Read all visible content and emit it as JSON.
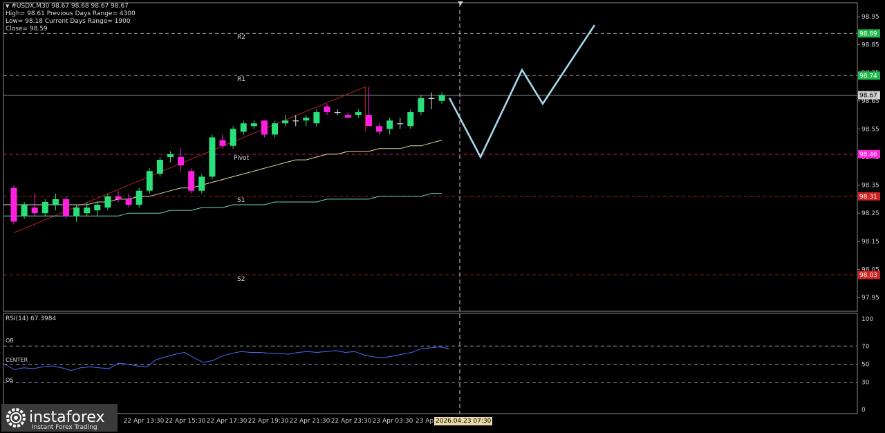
{
  "header": {
    "symbol_line": "#USDX,M30  98.67 98.68 98.67 98.67",
    "line2": "High= 98.61    Previous Days Range= 4300",
    "line3": "Low= 98.18    Current Days Range= 1900",
    "line4": "Close= 98.59"
  },
  "rsi": {
    "label": "RSI(14) 67.3984"
  },
  "levels_text": {
    "r2": "R2",
    "r1": "R1",
    "pivot": "Pivot",
    "s1": "S1",
    "s2": "S2",
    "ob": "OB",
    "center": "CENTER",
    "os": "OS"
  },
  "logo": {
    "name": "instaforex",
    "tagline": "Instant Forex Trading"
  },
  "cursor_time": "2026.04.23 07:30",
  "colors": {
    "bull": "#29e07a",
    "bear": "#ff1fe0",
    "forecast": "#a9d8f0",
    "rsi_line": "#4d6bff",
    "ma_slow": "#6fd6c0",
    "ma_fast": "#e8d9a6",
    "channel": "#b02020"
  },
  "chart_data": {
    "type": "candlestick",
    "price_axis": {
      "min": 97.95,
      "max": 98.95,
      "ticks": [
        "98.95",
        "98.85",
        "98.75",
        "98.65",
        "98.55",
        "98.45",
        "98.35",
        "98.25",
        "98.15",
        "98.05",
        "97.95"
      ]
    },
    "price_tags": [
      {
        "label": "98.89",
        "value": 98.89,
        "color": "#1fb84a",
        "level": "R2"
      },
      {
        "label": "98.74",
        "value": 98.74,
        "color": "#1fb84a",
        "level": "R1"
      },
      {
        "label": "98.67",
        "value": 98.67,
        "color": "#cfcfcf",
        "level": "current"
      },
      {
        "label": "98.46",
        "value": 98.46,
        "color": "#ff22dd",
        "level": "Pivot"
      },
      {
        "label": "98.31",
        "value": 98.31,
        "color": "#cc2222",
        "level": "S1"
      },
      {
        "label": "98.03",
        "value": 98.03,
        "color": "#cc2222",
        "level": "S2"
      }
    ],
    "time_labels": [
      "22 Apr 13:30",
      "22 Apr 15:30",
      "22 Apr 17:30",
      "22 Apr 19:30",
      "22 Apr 21:30",
      "22 Apr 23:30",
      "23 Apr 03:30",
      "23 Ap"
    ],
    "candles": [
      {
        "o": 98.34,
        "h": 98.35,
        "l": 98.21,
        "c": 98.22
      },
      {
        "o": 98.24,
        "h": 98.29,
        "l": 98.23,
        "c": 98.28
      },
      {
        "o": 98.27,
        "h": 98.32,
        "l": 98.24,
        "c": 98.25
      },
      {
        "o": 98.25,
        "h": 98.3,
        "l": 98.24,
        "c": 98.29
      },
      {
        "o": 98.28,
        "h": 98.32,
        "l": 98.26,
        "c": 98.3
      },
      {
        "o": 98.3,
        "h": 98.31,
        "l": 98.23,
        "c": 98.24
      },
      {
        "o": 98.24,
        "h": 98.28,
        "l": 98.22,
        "c": 98.27
      },
      {
        "o": 98.25,
        "h": 98.29,
        "l": 98.24,
        "c": 98.27
      },
      {
        "o": 98.26,
        "h": 98.29,
        "l": 98.24,
        "c": 98.28
      },
      {
        "o": 98.27,
        "h": 98.32,
        "l": 98.26,
        "c": 98.31
      },
      {
        "o": 98.31,
        "h": 98.33,
        "l": 98.29,
        "c": 98.3
      },
      {
        "o": 98.3,
        "h": 98.32,
        "l": 98.27,
        "c": 98.28
      },
      {
        "o": 98.28,
        "h": 98.34,
        "l": 98.27,
        "c": 98.33
      },
      {
        "o": 98.33,
        "h": 98.41,
        "l": 98.32,
        "c": 98.4
      },
      {
        "o": 98.39,
        "h": 98.45,
        "l": 98.38,
        "c": 98.44
      },
      {
        "o": 98.45,
        "h": 98.47,
        "l": 98.43,
        "c": 98.46
      },
      {
        "o": 98.45,
        "h": 98.48,
        "l": 98.4,
        "c": 98.42
      },
      {
        "o": 98.4,
        "h": 98.41,
        "l": 98.32,
        "c": 98.33
      },
      {
        "o": 98.33,
        "h": 98.39,
        "l": 98.32,
        "c": 98.38
      },
      {
        "o": 98.38,
        "h": 98.53,
        "l": 98.37,
        "c": 98.52
      },
      {
        "o": 98.51,
        "h": 98.53,
        "l": 98.48,
        "c": 98.49
      },
      {
        "o": 98.49,
        "h": 98.56,
        "l": 98.48,
        "c": 98.55
      },
      {
        "o": 98.54,
        "h": 98.58,
        "l": 98.53,
        "c": 98.57
      },
      {
        "o": 98.56,
        "h": 98.58,
        "l": 98.55,
        "c": 98.57
      },
      {
        "o": 98.58,
        "h": 98.58,
        "l": 98.52,
        "c": 98.53
      },
      {
        "o": 98.53,
        "h": 98.58,
        "l": 98.52,
        "c": 98.57
      },
      {
        "o": 98.57,
        "h": 98.6,
        "l": 98.56,
        "c": 98.58
      },
      {
        "o": 98.58,
        "h": 98.6,
        "l": 98.56,
        "c": 98.58
      },
      {
        "o": 98.58,
        "h": 98.6,
        "l": 98.56,
        "c": 98.59
      },
      {
        "o": 98.57,
        "h": 98.62,
        "l": 98.56,
        "c": 98.61
      },
      {
        "o": 98.63,
        "h": 98.64,
        "l": 98.6,
        "c": 98.61
      },
      {
        "o": 98.61,
        "h": 98.62,
        "l": 98.6,
        "c": 98.61
      },
      {
        "o": 98.6,
        "h": 98.61,
        "l": 98.59,
        "c": 98.59
      },
      {
        "o": 98.6,
        "h": 98.62,
        "l": 98.59,
        "c": 98.61
      },
      {
        "o": 98.6,
        "h": 98.7,
        "l": 98.56,
        "c": 98.56
      },
      {
        "o": 98.56,
        "h": 98.57,
        "l": 98.53,
        "c": 98.54
      },
      {
        "o": 98.55,
        "h": 98.59,
        "l": 98.53,
        "c": 98.58
      },
      {
        "o": 98.57,
        "h": 98.59,
        "l": 98.55,
        "c": 98.57
      },
      {
        "o": 98.56,
        "h": 98.62,
        "l": 98.55,
        "c": 98.61
      },
      {
        "o": 98.61,
        "h": 98.67,
        "l": 98.6,
        "c": 98.66
      },
      {
        "o": 98.66,
        "h": 98.68,
        "l": 98.62,
        "c": 98.66
      },
      {
        "o": 98.65,
        "h": 98.68,
        "l": 98.64,
        "c": 98.67
      }
    ],
    "ma_fast": [
      98.28,
      98.28,
      98.28,
      98.28,
      98.28,
      98.28,
      98.28,
      98.28,
      98.29,
      98.29,
      98.3,
      98.3,
      98.31,
      98.31,
      98.32,
      98.33,
      98.34,
      98.34,
      98.35,
      98.36,
      98.37,
      98.38,
      98.39,
      98.4,
      98.41,
      98.42,
      98.43,
      98.44,
      98.44,
      98.45,
      98.46,
      98.46,
      98.47,
      98.47,
      98.47,
      98.48,
      98.48,
      98.48,
      98.49,
      98.49,
      98.5,
      98.51
    ],
    "ma_slow": [
      98.24,
      98.24,
      98.24,
      98.24,
      98.24,
      98.24,
      98.24,
      98.24,
      98.24,
      98.24,
      98.24,
      98.25,
      98.25,
      98.25,
      98.25,
      98.26,
      98.26,
      98.26,
      98.27,
      98.27,
      98.27,
      98.28,
      98.28,
      98.28,
      98.28,
      98.29,
      98.29,
      98.29,
      98.29,
      98.29,
      98.3,
      98.3,
      98.3,
      98.3,
      98.3,
      98.31,
      98.31,
      98.31,
      98.31,
      98.31,
      98.32,
      98.32
    ],
    "channel": [
      {
        "i": 0,
        "p": 98.18
      },
      {
        "i": 34,
        "p": 98.7
      }
    ],
    "forecast_path": [
      {
        "step": 0,
        "p": 98.66
      },
      {
        "step": 3,
        "p": 98.45
      },
      {
        "step": 7,
        "p": 98.76
      },
      {
        "step": 9,
        "p": 98.64
      },
      {
        "step": 14,
        "p": 98.92
      }
    ],
    "rsi_axis": {
      "min": 0,
      "max": 100,
      "ticks": [
        "100",
        "70",
        "50",
        "30",
        "0"
      ],
      "ob": 70,
      "center": 50,
      "os": 30
    },
    "rsi_values": [
      50,
      44,
      46,
      45,
      47,
      48,
      46,
      43,
      46,
      47,
      46,
      45,
      51,
      50,
      48,
      47,
      55,
      58,
      61,
      63,
      57,
      52,
      54,
      59,
      62,
      64,
      63,
      63,
      62,
      62,
      61,
      63,
      64,
      63,
      64,
      65,
      63,
      64,
      60,
      58,
      57,
      59,
      61,
      63,
      67,
      68,
      69,
      67
    ]
  }
}
